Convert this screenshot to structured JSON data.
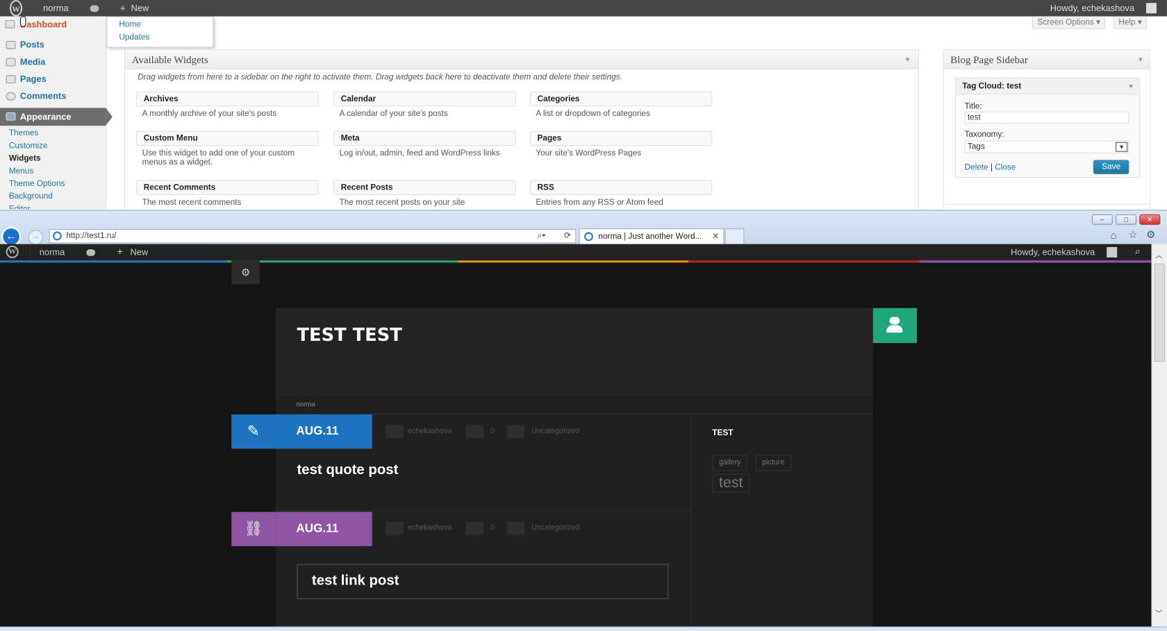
{
  "admin_bar": {
    "site": "norma",
    "new": "New",
    "howdy": "Howdy, echekashova"
  },
  "admin_menu": {
    "dashboard": "Dashboard",
    "flyout": [
      "Home",
      "Updates"
    ],
    "items": [
      "Posts",
      "Media",
      "Pages",
      "Comments"
    ],
    "appearance": "Appearance",
    "sub_items": [
      "Themes",
      "Customize",
      "Widgets",
      "Menus",
      "Theme Options",
      "Background",
      "Editor"
    ]
  },
  "screen_options": "Screen Options",
  "help": "Help",
  "available_widgets": {
    "title": "Available Widgets",
    "intro": "Drag widgets from here to a sidebar on the right to activate them. Drag widgets back here to deactivate them and delete their settings.",
    "widgets": [
      {
        "name": "Archives",
        "desc": "A monthly archive of your site's posts"
      },
      {
        "name": "Calendar",
        "desc": "A calendar of your site's posts"
      },
      {
        "name": "Categories",
        "desc": "A list or dropdown of categories"
      },
      {
        "name": "Custom Menu",
        "desc": "Use this widget to add one of your custom menus as a widget."
      },
      {
        "name": "Meta",
        "desc": "Log in/out, admin, feed and WordPress links"
      },
      {
        "name": "Pages",
        "desc": "Your site's WordPress Pages"
      },
      {
        "name": "Recent Comments",
        "desc": "The most recent comments"
      },
      {
        "name": "Recent Posts",
        "desc": "The most recent posts on your site"
      },
      {
        "name": "RSS",
        "desc": "Entries from any RSS or Atom feed"
      }
    ]
  },
  "blog_sidebar": {
    "title": "Blog Page Sidebar",
    "widget_title": "Tag Cloud: test",
    "title_label": "Title:",
    "title_value": "test",
    "taxonomy_label": "Taxonomy:",
    "taxonomy_value": "Tags",
    "delete": "Delete",
    "separator": "|",
    "close": "Close",
    "save": "Save"
  },
  "browser": {
    "url": "http://test1.ru/",
    "tab_title": "norma | Just another Word..."
  },
  "site": {
    "admin_site": "norma",
    "admin_new": "New",
    "admin_howdy": "Howdy, echekashova",
    "header_title": "TEST TEST",
    "breadcrumb": "norma",
    "posts": [
      {
        "date": "AUG.11",
        "author": "echekashova",
        "comments": "0",
        "category": "Uncategorized",
        "title": "test quote post",
        "color": "#1e73be",
        "icon": "pencil-icon"
      },
      {
        "date": "AUG.11",
        "author": "echekashova",
        "comments": "0",
        "category": "Uncategorized",
        "title": "test link post",
        "color": "#8e55a5",
        "icon": "link-icon"
      }
    ],
    "sidebar_widget_title": "TEST",
    "tags": [
      "gallery",
      "picture",
      "test"
    ],
    "stripe_colors": [
      "#1e73be",
      "#2ba06b",
      "#e08a1e",
      "#b81e1e",
      "#8e55a5"
    ],
    "accent": "#1fa67a"
  }
}
